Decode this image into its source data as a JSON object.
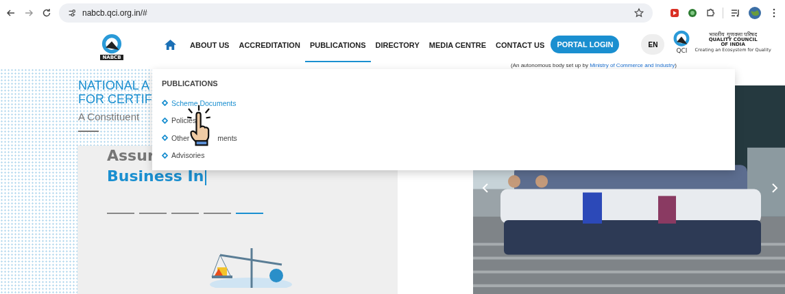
{
  "browser": {
    "url": "nabcb.qci.org.in/#"
  },
  "header": {
    "logo_text": "NABCB",
    "nav": [
      {
        "label": "ABOUT US",
        "selected": false
      },
      {
        "label": "ACCREDITATION",
        "selected": false
      },
      {
        "label": "PUBLICATIONS",
        "selected": true
      },
      {
        "label": "DIRECTORY",
        "selected": false
      },
      {
        "label": "MEDIA CENTRE",
        "selected": false
      },
      {
        "label": "CONTACT US",
        "selected": false
      }
    ],
    "portal_button": "PORTAL LOGIN",
    "language": "EN",
    "qci": {
      "mark": "QCI",
      "hindi": "भारतीय गुणवत्ता परिषद",
      "line1": "QUALITY COUNCIL",
      "line2": "OF INDIA",
      "tagline": "Creating an Ecosystem for Quality"
    },
    "autonomy_note": {
      "prefix": "(An autonomous body set up by ",
      "link": "Ministry of Commerce and Industry",
      "suffix": ")"
    }
  },
  "dropdown": {
    "heading": "PUBLICATIONS",
    "items": [
      {
        "label": "Scheme Documents",
        "selected": true
      },
      {
        "label": "Policies",
        "selected": false
      },
      {
        "label": "Other",
        "label_end": "ments",
        "selected": false
      },
      {
        "label": "Advisories",
        "selected": false
      }
    ]
  },
  "hero": {
    "title_lines": [
      "NATIONAL A",
      "FOR CERTIF"
    ],
    "subtitle": "A Constituent",
    "slogan_line1": "Assur",
    "slogan_line2": "Business In",
    "slides": [
      {
        "selected": false
      },
      {
        "selected": false
      },
      {
        "selected": false
      },
      {
        "selected": false
      },
      {
        "selected": true
      }
    ]
  }
}
